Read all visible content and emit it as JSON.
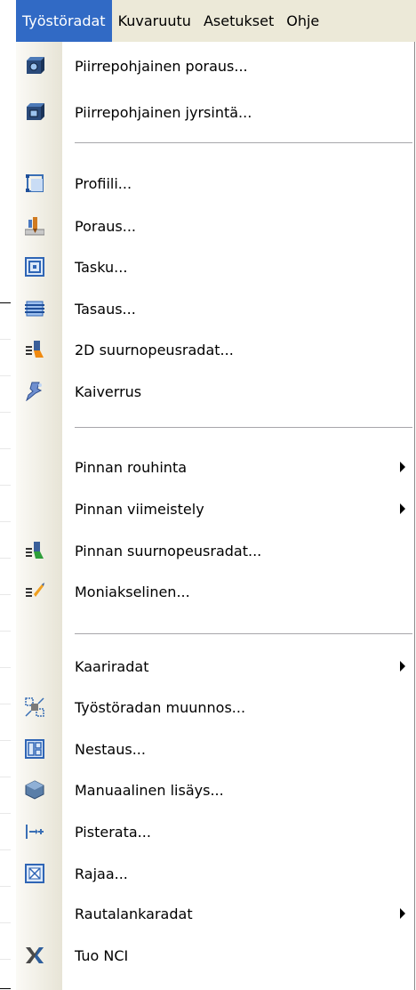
{
  "menubar": {
    "items": [
      "Työstöradat",
      "Kuvaruutu",
      "Asetukset",
      "Ohje"
    ]
  },
  "menu": {
    "items": [
      {
        "label": "Piirrepohjainen poraus...",
        "icon": "feature-drill-icon"
      },
      {
        "label": "Piirrepohjainen jyrsintä...",
        "icon": "feature-mill-icon"
      },
      {
        "label": "Profiili...",
        "icon": "contour-icon"
      },
      {
        "label": "Poraus...",
        "icon": "drill-icon"
      },
      {
        "label": "Tasku...",
        "icon": "pocket-icon"
      },
      {
        "label": "Tasaus...",
        "icon": "facing-icon"
      },
      {
        "label": "2D suurnopeusradat...",
        "icon": "hst-2d-icon"
      },
      {
        "label": "Kaiverrus",
        "icon": "engrave-icon"
      },
      {
        "label": "Pinnan rouhinta",
        "submenu": true
      },
      {
        "label": "Pinnan viimeistely",
        "submenu": true
      },
      {
        "label": "Pinnan suurnopeusradat...",
        "icon": "surface-hst-icon"
      },
      {
        "label": "Moniakselinen...",
        "icon": "multiaxis-icon"
      },
      {
        "label": "Kaariradat",
        "submenu": true
      },
      {
        "label": "Työstöradan muunnos...",
        "icon": "transform-icon"
      },
      {
        "label": "Nestaus...",
        "icon": "nesting-icon"
      },
      {
        "label": "Manuaalinen lisäys...",
        "icon": "manual-entry-icon"
      },
      {
        "label": "Pisterata...",
        "icon": "point-icon"
      },
      {
        "label": "Rajaa...",
        "icon": "trim-icon"
      },
      {
        "label": "Rautalankaradat",
        "submenu": true
      },
      {
        "label": "Tuo NCI",
        "icon": "import-nci-icon"
      }
    ]
  },
  "colors": {
    "highlight": "#316ac5",
    "menubar_bg": "#ece9d8",
    "gutter_bg": "#e7e4d6"
  }
}
